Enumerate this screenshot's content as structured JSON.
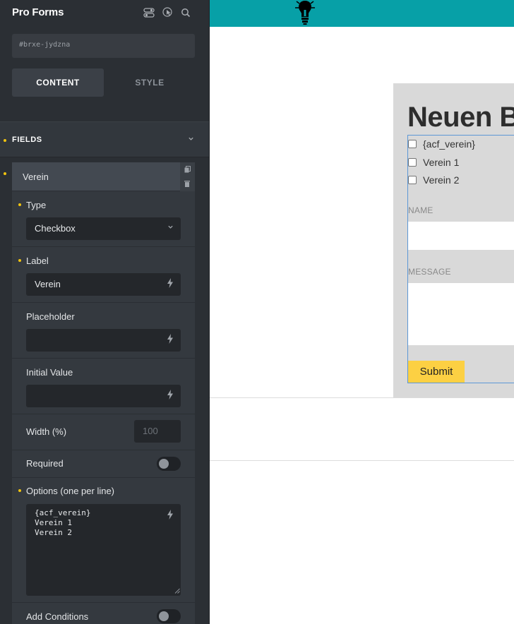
{
  "panel": {
    "title": "Pro Forms",
    "element_id": "#brxe-jydzna",
    "tabs": [
      "CONTENT",
      "STYLE"
    ],
    "active_tab": "CONTENT",
    "section_label": "FIELDS",
    "field_item": {
      "name": "Verein",
      "type_label": "Type",
      "type_value": "Checkbox",
      "label_label": "Label",
      "label_value": "Verein",
      "placeholder_label": "Placeholder",
      "placeholder_value": "",
      "initial_value_label": "Initial Value",
      "initial_value": "",
      "width_label": "Width (%)",
      "width_placeholder": "100",
      "required_label": "Required",
      "required_on": false,
      "options_label": "Options (one per line)",
      "options_value": "{acf_verein}\nVerein 1\nVerein 2",
      "add_conditions_label": "Add Conditions",
      "add_conditions_on": false
    },
    "icons": [
      "toggle-icon",
      "pointer-icon",
      "search-icon",
      "bolt-icon",
      "copy-icon",
      "trash-icon"
    ]
  },
  "preview": {
    "heading": "Neuen B",
    "checkbox_options": [
      "{acf_verein}",
      "Verein 1",
      "Verein 2"
    ],
    "name_label": "NAME",
    "message_label": "MESSAGE",
    "submit_label": "Submit"
  },
  "colors": {
    "panel_bg": "#2b2f34",
    "accent_dot": "#f1c40f",
    "topbar": "#07a0a7",
    "submit_bg": "#fcd043",
    "form_outline": "#5c97d6"
  }
}
